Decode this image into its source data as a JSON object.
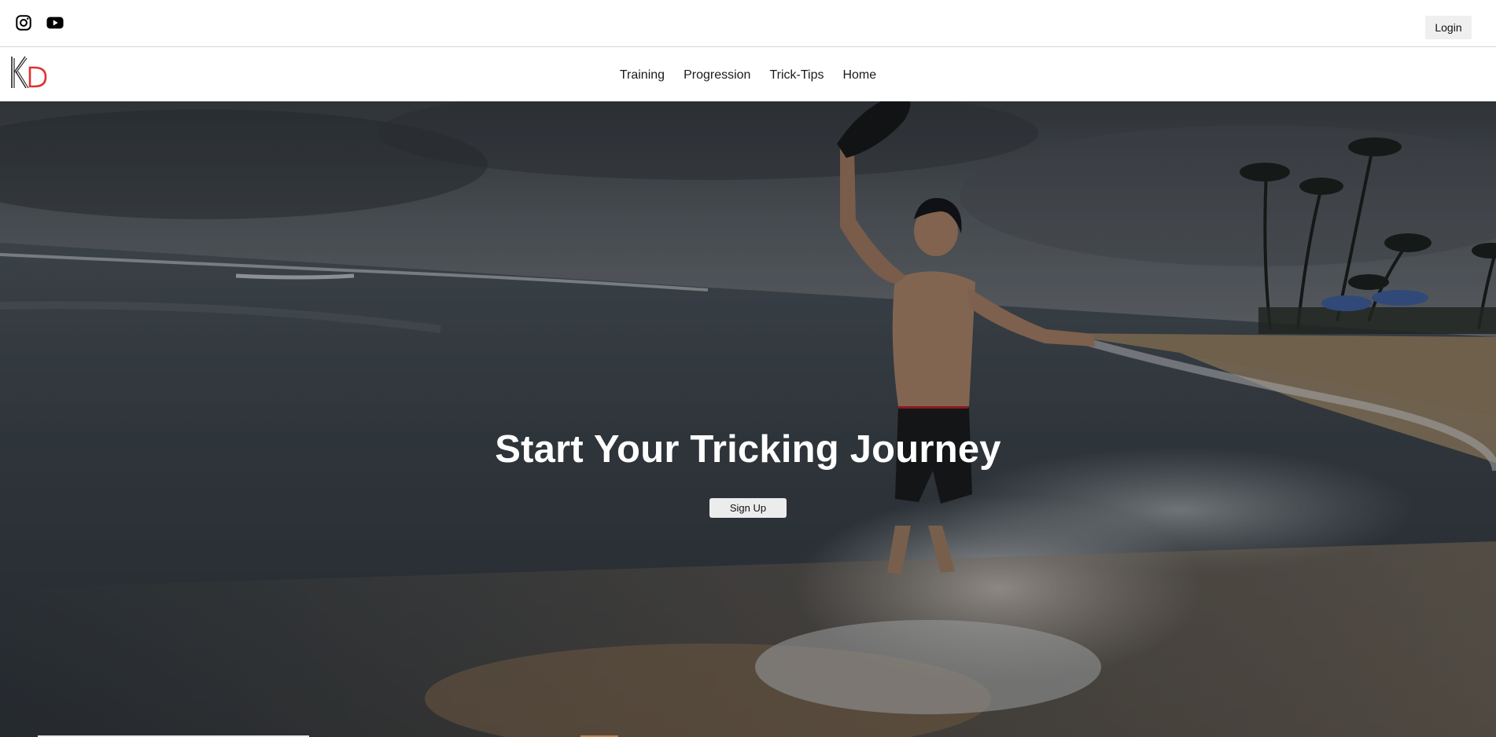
{
  "topbar": {
    "social": [
      {
        "icon": "instagram-icon"
      },
      {
        "icon": "youtube-icon"
      }
    ],
    "login_label": "Login"
  },
  "navbar": {
    "logo": {
      "letters": "KD",
      "colors": {
        "k": "#222222",
        "d": "#e0312d"
      }
    },
    "links": [
      "Training",
      "Progression",
      "Trick-Tips",
      "Home"
    ]
  },
  "hero": {
    "title": "Start Your Tricking Journey",
    "signup_label": "Sign Up",
    "background_description_colors": {
      "sky": "#4c5258",
      "sea": "#3e464c",
      "sand": "#b49a7a"
    }
  }
}
